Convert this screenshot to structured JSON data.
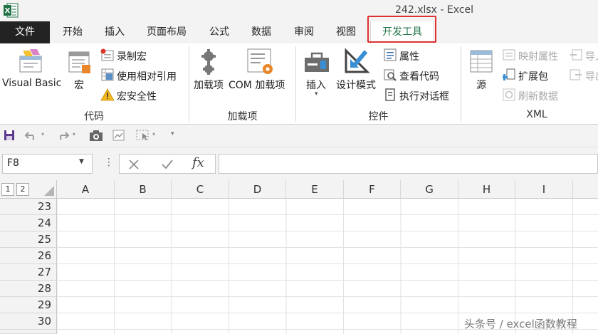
{
  "window": {
    "title": "242.xlsx - Excel",
    "app_icon": "excel-logo-icon"
  },
  "tabs": [
    {
      "label": "文件",
      "active": false
    },
    {
      "label": "开始",
      "active": false
    },
    {
      "label": "插入",
      "active": false
    },
    {
      "label": "页面布局",
      "active": false
    },
    {
      "label": "公式",
      "active": false
    },
    {
      "label": "数据",
      "active": false
    },
    {
      "label": "审阅",
      "active": false
    },
    {
      "label": "视图",
      "active": false
    },
    {
      "label": "开发工具",
      "active": true
    }
  ],
  "ribbon": {
    "code": {
      "group_label": "代码",
      "visual_basic": "Visual Basic",
      "macros": "宏",
      "record_macro": "录制宏",
      "relative_refs": "使用相对引用",
      "macro_security": "宏安全性"
    },
    "addins": {
      "group_label": "加载项",
      "addins": "加载项",
      "com_addins": "COM 加载项"
    },
    "controls": {
      "group_label": "控件",
      "insert": "插入",
      "design_mode": "设计模式",
      "properties": "属性",
      "view_code": "查看代码",
      "run_dialog": "执行对话框"
    },
    "xml": {
      "group_label": "XML",
      "source": "源",
      "map_properties": "映射属性",
      "expansion_packs": "扩展包",
      "refresh_data": "刷新数据",
      "import": "导入",
      "export": "导出"
    }
  },
  "formula_bar": {
    "name_box": "F8",
    "fx_label": "fx",
    "formula": ""
  },
  "sheet": {
    "outline_levels": [
      "1",
      "2"
    ],
    "columns": [
      "A",
      "B",
      "C",
      "D",
      "E",
      "F",
      "G",
      "H",
      "I"
    ],
    "rows": [
      "23",
      "24",
      "25",
      "26",
      "27",
      "28",
      "29",
      "30"
    ]
  },
  "watermark": "头条号 / excel函数教程",
  "colors": {
    "accent": "#217346",
    "highlight_box": "#e03030",
    "file_tab": "#232323"
  }
}
